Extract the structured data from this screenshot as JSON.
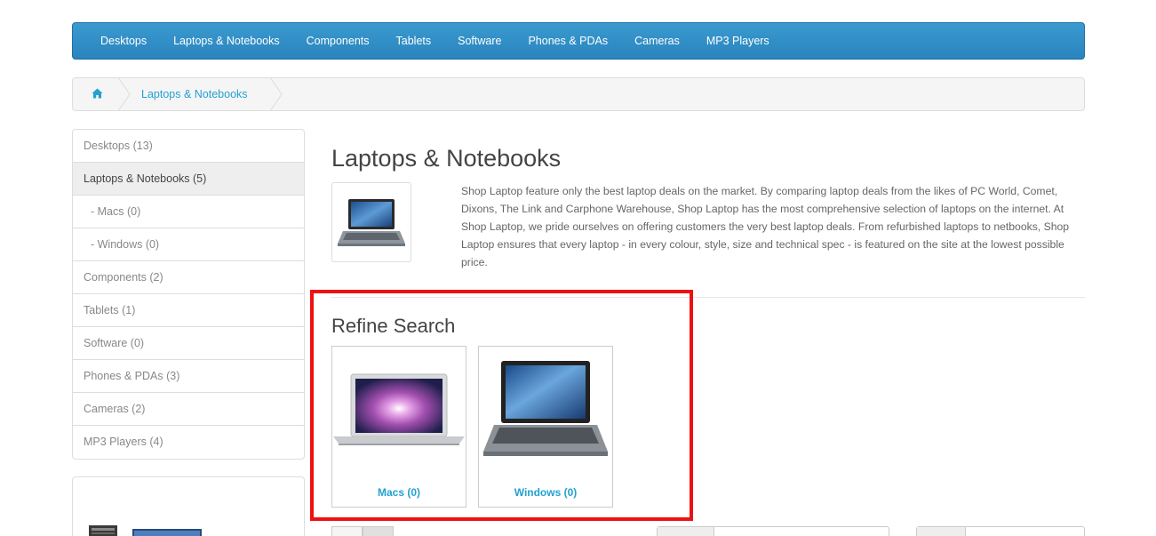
{
  "menu": {
    "items": [
      "Desktops",
      "Laptops & Notebooks",
      "Components",
      "Tablets",
      "Software",
      "Phones & PDAs",
      "Cameras",
      "MP3 Players"
    ]
  },
  "breadcrumb": {
    "home_icon": "home-icon",
    "current": "Laptops & Notebooks"
  },
  "sidebar": {
    "items": [
      {
        "label": "Desktops (13)"
      },
      {
        "label": "Laptops & Notebooks (5)"
      },
      {
        "label": "- Macs (0)"
      },
      {
        "label": "- Windows (0)"
      },
      {
        "label": "Components (2)"
      },
      {
        "label": "Tablets (1)"
      },
      {
        "label": "Software (0)"
      },
      {
        "label": "Phones & PDAs (3)"
      },
      {
        "label": "Cameras (2)"
      },
      {
        "label": "MP3 Players (4)"
      }
    ]
  },
  "category": {
    "title": "Laptops & Notebooks",
    "description": "Shop Laptop feature only the best laptop deals on the market. By comparing laptop deals from the likes of PC World, Comet, Dixons, The Link and Carphone Warehouse, Shop Laptop has the most comprehensive selection of laptops on the internet. At Shop Laptop, we pride ourselves on offering customers the very best laptop deals. From refurbished laptops to netbooks, Shop Laptop ensures that every laptop - in every colour, style, size and technical spec - is featured on the site at the lowest possible price."
  },
  "refine": {
    "title": "Refine Search",
    "cards": [
      {
        "label": "Macs (0)"
      },
      {
        "label": "Windows (0)"
      }
    ]
  },
  "colors": {
    "accent": "#23a1d1",
    "menu_bg": "#2f8fc9",
    "highlight": "#ee1111"
  }
}
